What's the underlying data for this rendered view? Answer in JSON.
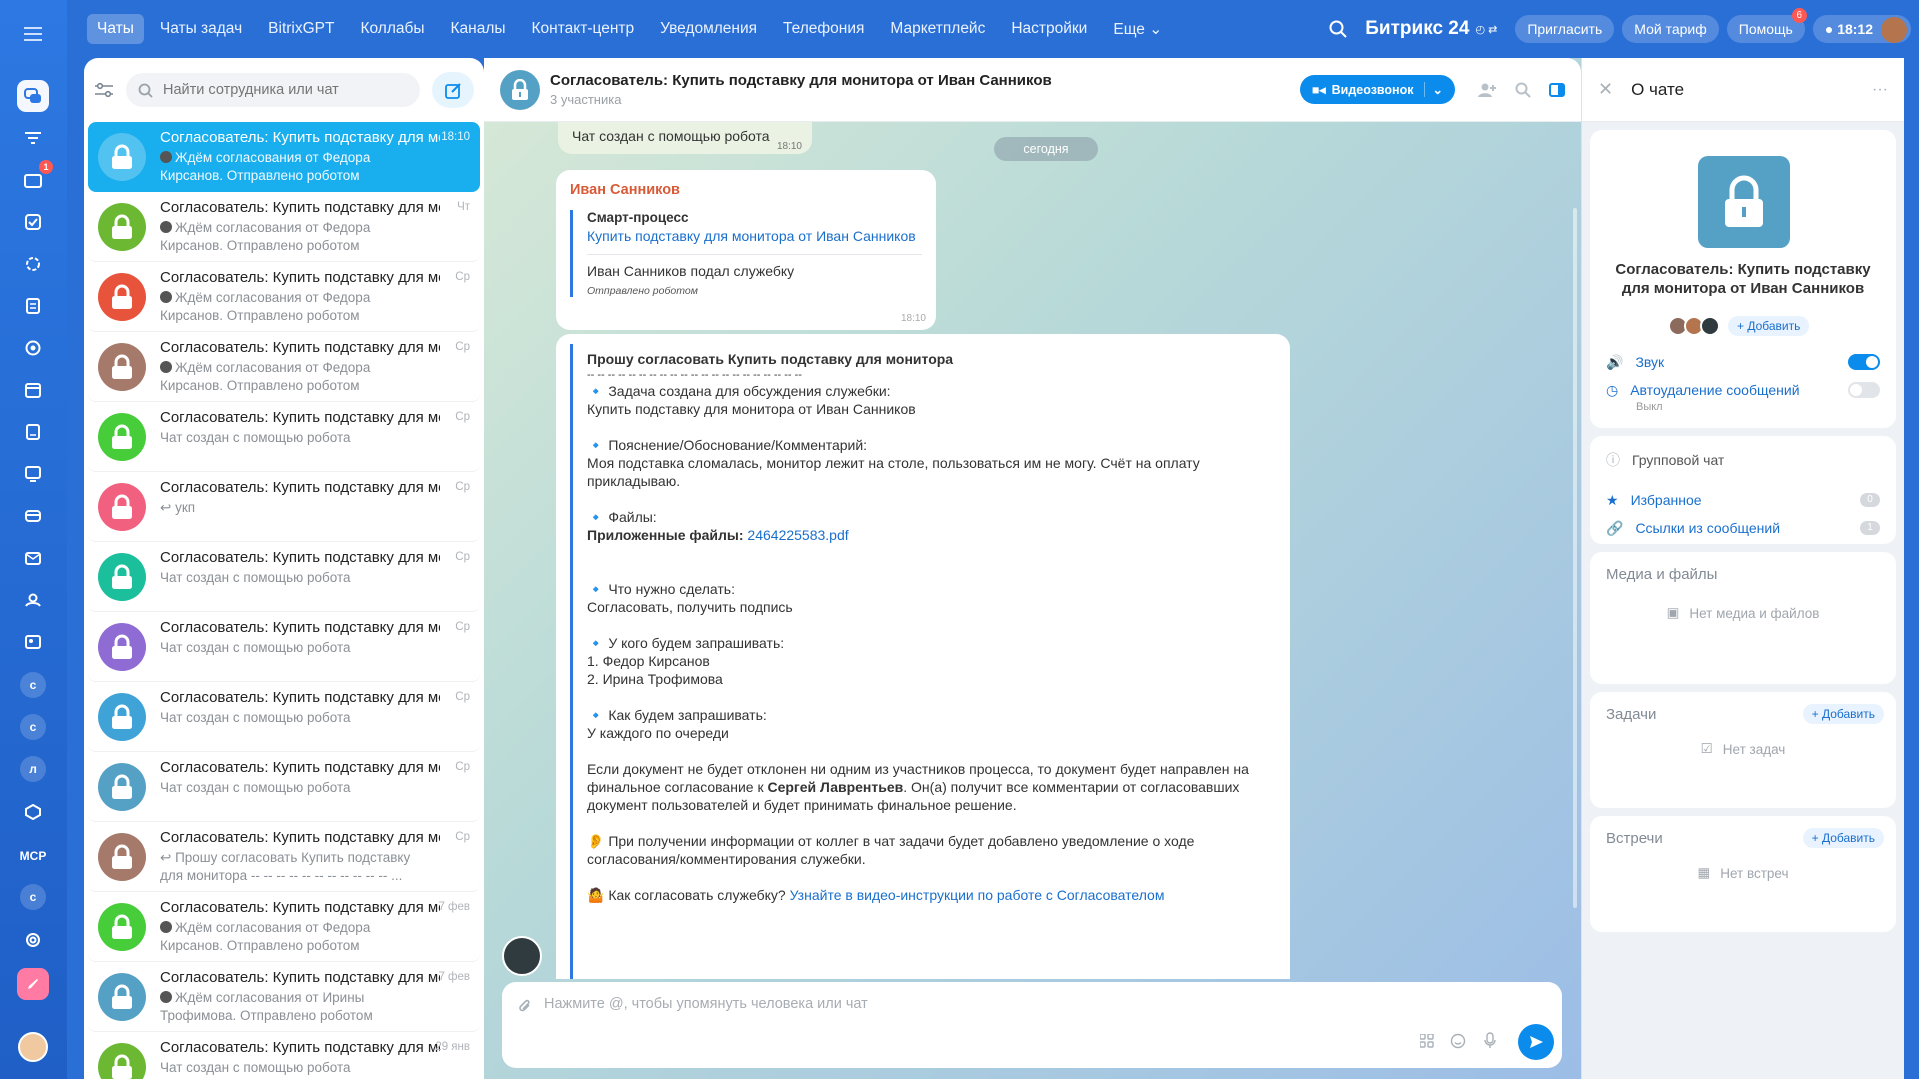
{
  "nav": {
    "items": [
      "Чаты",
      "Чаты задач",
      "BitrixGPT",
      "Коллабы",
      "Каналы",
      "Контакт-центр",
      "Уведомления",
      "Телефония",
      "Маркетплейс",
      "Настройки",
      "Еще"
    ],
    "brand": "Битрикс 24",
    "invite": "Пригласить",
    "tariff": "Мой тариф",
    "help": "Помощь",
    "help_badge": "6",
    "time": "18:12"
  },
  "rail": {
    "badge": "1",
    "letters": [
      "с",
      "с",
      "л",
      "МСР",
      "с"
    ]
  },
  "search": {
    "placeholder": "Найти сотрудника или чат"
  },
  "chats": [
    {
      "title": "Согласователь: Купить подставку для монитора",
      "time": "18:10",
      "line1": "Ждём согласования от Федора",
      "line2": "Кирсанов. Отправлено роботом",
      "color": "#19aeed"
    },
    {
      "title": "Согласователь: Купить подставку для монитора",
      "time": "Чт",
      "line1": "Ждём согласования от Федора",
      "line2": "Кирсанов. Отправлено роботом",
      "color": "#6cb833"
    },
    {
      "title": "Согласователь: Купить подставку для монитора",
      "time": "Ср",
      "line1": "Ждём согласования от Федора",
      "line2": "Кирсанов. Отправлено роботом",
      "color": "#e8533b"
    },
    {
      "title": "Согласователь: Купить подставку для монитора",
      "time": "Ср",
      "line1": "Ждём согласования от Федора",
      "line2": "Кирсанов. Отправлено роботом",
      "color": "#a57a6a"
    },
    {
      "title": "Согласователь: Купить подставку для монитора",
      "time": "Ср",
      "line1": "Чат создан с помощью робота",
      "line2": "",
      "color": "#47cc3a"
    },
    {
      "title": "Согласователь: Купить подставку для монитора",
      "time": "Ср",
      "line1": "укп",
      "line2": "",
      "color": "#f2607f"
    },
    {
      "title": "Согласователь: Купить подставку для монитора",
      "time": "Ср",
      "line1": "Чат создан с помощью робота",
      "line2": "",
      "color": "#1bbf9c"
    },
    {
      "title": "Согласователь: Купить подставку для монитора",
      "time": "Ср",
      "line1": "Чат создан с помощью робота",
      "line2": "",
      "color": "#8f6bd4"
    },
    {
      "title": "Согласователь: Купить подставку для монитора",
      "time": "Ср",
      "line1": "Чат создан с помощью робота",
      "line2": "",
      "color": "#3fa3d8"
    },
    {
      "title": "Согласователь: Купить подставку для монитора",
      "time": "Ср",
      "line1": "Чат создан с помощью робота",
      "line2": "",
      "color": "#55a1c5"
    },
    {
      "title": "Согласователь: Купить подставку для монитора",
      "time": "Ср",
      "line1": "Прошу согласовать Купить подставку",
      "line2": "для монитора -- -- -- -- -- -- -- -- -- -- -- ...",
      "color": "#a57a6a"
    },
    {
      "title": "Согласователь: Купить подставку для монитора",
      "time": "7 фев",
      "line1": "Ждём согласования от Федора",
      "line2": "Кирсанов. Отправлено роботом",
      "color": "#47cc3a"
    },
    {
      "title": "Согласователь: Купить подставку для монитора",
      "time": "7 фев",
      "line1": "Ждём согласования от Ирины",
      "line2": "Трофимова. Отправлено роботом",
      "color": "#55a1c5"
    },
    {
      "title": "Согласователь: Купить подставку для монитора",
      "time": "29 янв",
      "line1": "Чат создан с помощью робота",
      "line2": "",
      "color": "#6cb833"
    }
  ],
  "header": {
    "title": "Согласователь: Купить подставку для монитора от Иван Санников",
    "members": "3 участника",
    "video": "Видеозвонок"
  },
  "system": {
    "text": "Чат создан с помощью робота",
    "time": "18:10"
  },
  "today": "сегодня",
  "msg1": {
    "author": "Иван Санников",
    "label": "Смарт-процесс",
    "link": "Купить подставку для монитора от Иван Санников",
    "text": "Иван Санников подал служебку",
    "note": "Отправлено роботом",
    "time": "18:10"
  },
  "msg2": {
    "title": "Прошу согласовать Купить подставку для монитора",
    "dash": "-- -- -- -- -- -- -- -- -- -- -- -- -- -- -- -- -- -- -- -- --",
    "h1": "🔹 Задача создана для обсуждения служебки:",
    "t1": "Купить подставку для монитора от Иван Санников",
    "h2": "🔹 Пояснение/Обоснование/Комментарий:",
    "t2a": "Моя подставка сломалась, монитор лежит на столе, пользоваться им не могу. Счёт на оплату",
    "t2b": "прикладываю.",
    "h3": "🔹 Файлы:",
    "files_label": "Приложенные файлы:",
    "file": "2464225583.pdf",
    "h4": "🔹 Что нужно сделать:",
    "t4": "Согласовать, получить подпись",
    "h5": "🔹 У кого будем запрашивать:",
    "t5a": "1. Федор Кирсанов",
    "t5b": "2. Ирина Трофимова",
    "h6": "🔹 Как будем запрашивать:",
    "t6": "У каждого по очереди",
    "p1a": "Если документ не будет отклонен ни одним из участников процесса, то документ будет направлен на",
    "p1b": "финальное согласование к",
    "p1name": "Сергей Лаврентьев",
    "p1c": ". Он(а) получит все комментарии от согласовавших",
    "p1d": "документ пользователей и будет принимать финальное решение.",
    "p2a": "👂 При получении информации от коллег в чат задачи будет добавлено уведомление о ходе",
    "p2b": "согласования/комментирования служебки.",
    "p3": "🤷 Как согласовать служебку?",
    "p3link": "Узнайте в видео-инструкции по работе с Согласователом"
  },
  "input": {
    "placeholder": "Нажмите @, чтобы упомянуть человека или чат"
  },
  "about": {
    "title": "О чате",
    "name": "Согласователь: Купить подставку для монитора от Иван Санников",
    "add": "+ Добавить",
    "sound": "Звук",
    "autodelete": "Автоудаление сообщений",
    "autodelete_state": "Выкл",
    "group": "Групповой чат",
    "fav": "Избранное",
    "fav_count": "0",
    "links": "Ссылки из сообщений",
    "links_count": "1",
    "media_title": "Медиа и файлы",
    "media_empty": "Нет медиа и файлов",
    "tasks_title": "Задачи",
    "tasks_empty": "Нет задач",
    "meet_title": "Встречи",
    "meet_empty": "Нет встреч"
  },
  "colors": {
    "accent": "#19aeed",
    "brand": "#2d78e2",
    "link": "#1a6fcd",
    "author": "#d85b38"
  }
}
